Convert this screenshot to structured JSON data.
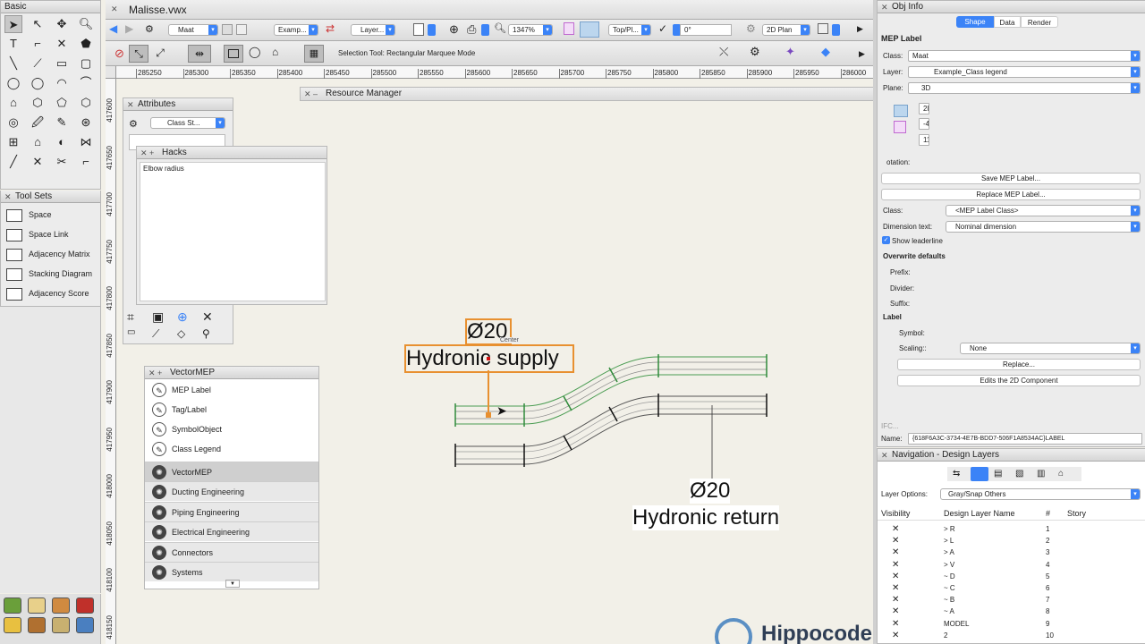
{
  "basic_palette": {
    "title": "Basic"
  },
  "toolsets": {
    "title": "Tool Sets",
    "items": [
      {
        "label": "Space",
        "icon": "space-icon"
      },
      {
        "label": "Space Link",
        "icon": "space-link-icon"
      },
      {
        "label": "Adjacency Matrix",
        "icon": "adjacency-matrix-icon"
      },
      {
        "label": "Stacking Diagram",
        "icon": "stacking-diagram-icon"
      },
      {
        "label": "Adjacency Score",
        "icon": "adjacency-score-icon"
      }
    ]
  },
  "document": {
    "title": "Malisse.vwx"
  },
  "toolbar": {
    "class_value": "Maat",
    "layer_value": "Examp...",
    "layer_label": "Layer...",
    "zoom": "1347%",
    "view": "Top/Pl...",
    "angle": "0°",
    "render": "2D Plan"
  },
  "mode_bar": {
    "status": "Selection Tool: Rectangular Marquee Mode"
  },
  "ruler": {
    "h_ticks": [
      "285250",
      "285300",
      "285350",
      "285400",
      "285450",
      "285500",
      "285550",
      "285600",
      "285650",
      "285700",
      "285750",
      "285800",
      "285850",
      "285900",
      "285950",
      "286000"
    ],
    "v_ticks": [
      "417600",
      "417650",
      "417700",
      "417750",
      "417800",
      "417850",
      "417900",
      "417950",
      "418000",
      "418050",
      "418100",
      "418150"
    ]
  },
  "attributes": {
    "title": "Attributes",
    "class_style": "Class St..."
  },
  "hacks": {
    "title": "Hacks",
    "content": "Elbow radius"
  },
  "resource_manager": {
    "title": "Resource Manager"
  },
  "vectormep": {
    "title": "VectorMEP",
    "tools": [
      {
        "label": "MEP Label",
        "icon": "mep-label-icon"
      },
      {
        "label": "Tag/Label",
        "icon": "tag-label-icon"
      },
      {
        "label": "SymbolObject",
        "icon": "symbol-object-icon"
      },
      {
        "label": "Class Legend",
        "icon": "class-legend-icon"
      }
    ],
    "sets": [
      {
        "label": "VectorMEP",
        "icon": "vectormep-icon"
      },
      {
        "label": "Ducting Engineering",
        "icon": "ducting-icon"
      },
      {
        "label": "Piping Engineering",
        "icon": "piping-icon"
      },
      {
        "label": "Electrical Engineering",
        "icon": "electrical-icon"
      },
      {
        "label": "Connectors",
        "icon": "connectors-icon"
      },
      {
        "label": "Systems",
        "icon": "systems-icon"
      }
    ]
  },
  "drawing": {
    "supply_dim": "Ø20",
    "supply_name": "Hydronic supply",
    "snap_hint": "Center",
    "return_dim": "Ø20",
    "return_name": "Hydronic return",
    "watermark": "Hippocode"
  },
  "obj_info": {
    "title": "Obj Info",
    "tabs": [
      "Shape",
      "Data",
      "Render"
    ],
    "object_type": "MEP Label",
    "class_label": "Class:",
    "class_value": "Maat",
    "layer_label": "Layer:",
    "layer_value": "Example_Class legend",
    "plane_label": "Plane:",
    "plane_value": "3D",
    "mini_values": [
      "2l",
      "-4",
      "11"
    ],
    "rotation_label": "otation:",
    "save_btn": "Save MEP Label...",
    "replace_btn": "Replace MEP Label...",
    "class2_label": "Class:",
    "class2_value": "<MEP Label Class>",
    "dimtext_label": "Dimension text:",
    "dimtext_value": "Nominal dimension",
    "show_leader": "Show leaderline",
    "overwrite": "Overwrite defaults",
    "prefix": "Prefix:",
    "divider": "Divider:",
    "suffix": "Suffix:",
    "label_section": "Label",
    "symbol": "Symbol:",
    "scaling_label": "Scaling::",
    "scaling_value": "None",
    "replace": "Replace...",
    "edit2d": "Edits the 2D Component",
    "ifc": "IFC...",
    "name_label": "Name:",
    "name_value": "{618F6A3C-3734-4E7B-BDD7-506F1A8534AC}LABEL"
  },
  "navigation": {
    "title": "Navigation - Design Layers",
    "layer_options_label": "Layer Options:",
    "layer_options_value": "Gray/Snap Others",
    "columns": [
      "Visibility",
      "Design Layer Name",
      "#",
      "Story"
    ],
    "rows": [
      {
        "name": "> R",
        "num": "1"
      },
      {
        "name": "> L",
        "num": "2"
      },
      {
        "name": "> A",
        "num": "3"
      },
      {
        "name": "> V",
        "num": "4"
      },
      {
        "name": "~ D",
        "num": "5"
      },
      {
        "name": "~ C",
        "num": "6"
      },
      {
        "name": "~ B",
        "num": "7"
      },
      {
        "name": "~ A",
        "num": "8"
      },
      {
        "name": "MODEL",
        "num": "9"
      },
      {
        "name": "2",
        "num": "10"
      }
    ]
  }
}
